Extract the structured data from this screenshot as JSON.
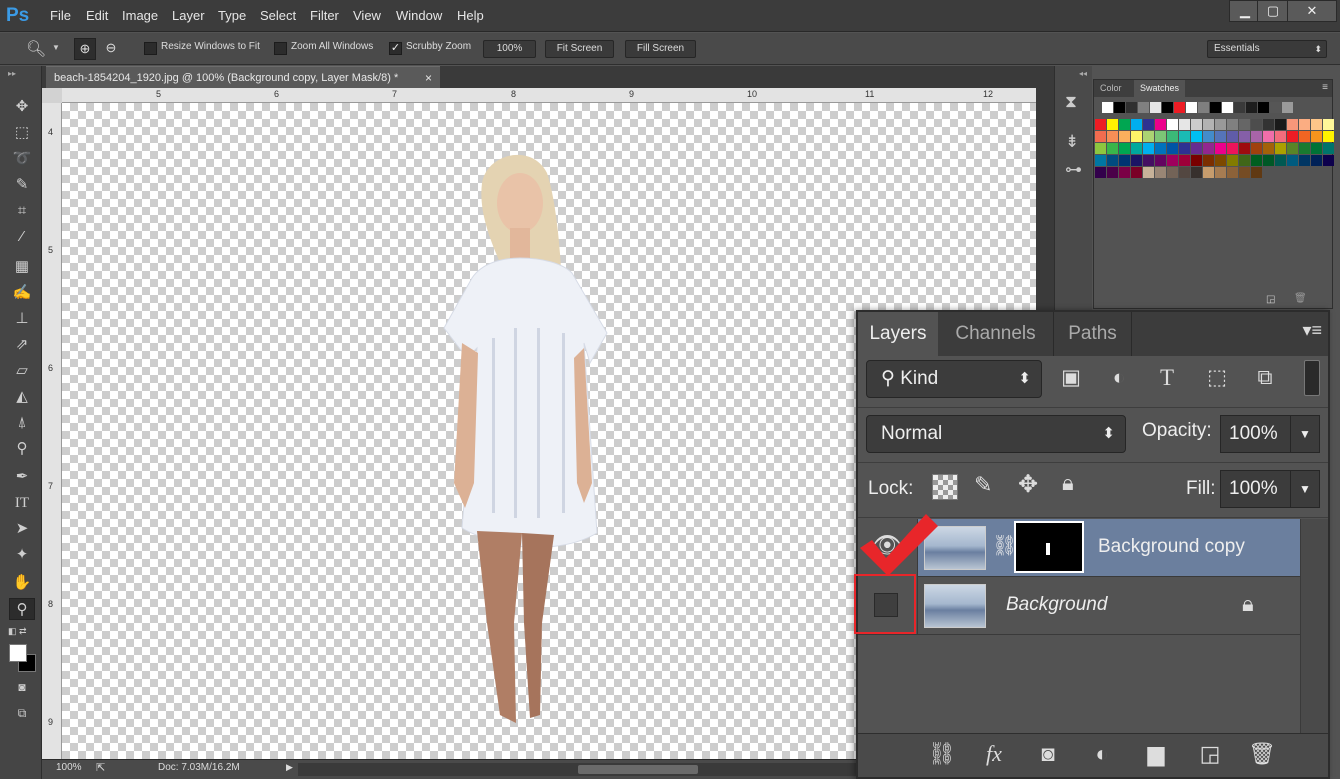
{
  "app": {
    "logo": "Ps"
  },
  "menu": [
    "File",
    "Edit",
    "Image",
    "Layer",
    "Type",
    "Select",
    "Filter",
    "View",
    "Window",
    "Help"
  ],
  "window_controls": {
    "minimize": "▁",
    "restore": "▢",
    "close": "✕"
  },
  "options_bar": {
    "resize_windows_label": "Resize Windows to Fit",
    "zoom_all_label": "Zoom All Windows",
    "scrubby_zoom_label": "Scrubby Zoom",
    "zoom_100_label": "100%",
    "fit_screen_label": "Fit Screen",
    "fill_screen_label": "Fill Screen",
    "workspace": "Essentials",
    "resize_windows_checked": false,
    "zoom_all_checked": false,
    "scrubby_zoom_checked": true
  },
  "document": {
    "tab_title": "beach-1854204_1920.jpg @ 100% (Background copy, Layer Mask/8) *",
    "close": "×"
  },
  "rulers": {
    "top": [
      "5",
      "6",
      "7",
      "8",
      "9",
      "10",
      "11",
      "12"
    ],
    "left": [
      "4",
      "5",
      "6",
      "7",
      "8",
      "9"
    ]
  },
  "status": {
    "zoom": "100%",
    "doc": "Doc: 7.03M/16.2M"
  },
  "swatches": {
    "tabs": [
      "Color",
      "Swatches"
    ],
    "active_tab": "Swatches",
    "row0": [
      "#ffffff",
      "#000000",
      "#303030",
      "#808080",
      "#e6e6e6",
      "#000000",
      "#ed1c24",
      "#ffffff",
      "#7f7f7f",
      "#000000",
      "#ffffff",
      "#3a3a3a",
      "#1e1e1e",
      "#000000",
      "#565656",
      "#9a9a9a"
    ],
    "grid": [
      [
        "#ed1c24",
        "#fff200",
        "#00a651",
        "#00aeef",
        "#2e3192",
        "#ec008c",
        "#ffffff",
        "#e6e6e6",
        "#cccccc",
        "#b3b3b3",
        "#999999",
        "#808080",
        "#666666",
        "#4d4d4d",
        "#333333",
        "#1a1a1a",
        "#f7977a",
        "#fbad82",
        "#fdc689",
        "#fff799"
      ],
      [
        "#f26c4f",
        "#f68e56",
        "#fbaf5d",
        "#fff568",
        "#acd372",
        "#7cc576",
        "#3bb878",
        "#1abbb4",
        "#00bff3",
        "#438ccb",
        "#5574b9",
        "#605ca8",
        "#855fa8",
        "#a864a8",
        "#f06eaa",
        "#f26d7d",
        "#ed1c24",
        "#f26522",
        "#f7941d",
        "#fff200"
      ],
      [
        "#8dc63f",
        "#39b54a",
        "#00a651",
        "#00a99d",
        "#00aeef",
        "#0072bc",
        "#0054a6",
        "#2e3192",
        "#662d91",
        "#92278f",
        "#ec008c",
        "#ed145b",
        "#9e0b0f",
        "#a0410d",
        "#a36209",
        "#aba000",
        "#598527",
        "#197b30",
        "#007236",
        "#00746b"
      ],
      [
        "#0076a3",
        "#004b80",
        "#003471",
        "#1b1464",
        "#440e62",
        "#630460",
        "#9e005d",
        "#9e0039",
        "#790000",
        "#7b2e00",
        "#7d4900",
        "#827b00",
        "#406618",
        "#005e20",
        "#005826",
        "#005952",
        "#005b7f",
        "#003663",
        "#002157",
        "#0d004c"
      ],
      [
        "#32004b",
        "#4b0049",
        "#7b0046",
        "#7a0026",
        "#c7b299",
        "#998675",
        "#736357",
        "#534741",
        "#37302d",
        "#c69c6d",
        "#a67c52",
        "#8c6239",
        "#754c24",
        "#603913"
      ]
    ]
  },
  "layers": {
    "tabs": [
      "Layers",
      "Channels",
      "Paths"
    ],
    "active_tab": "Layers",
    "filter_kind": "Kind",
    "blend_mode": "Normal",
    "opacity_label": "Opacity:",
    "opacity_value": "100%",
    "lock_label": "Lock:",
    "fill_label": "Fill:",
    "fill_value": "100%",
    "items": [
      {
        "name": "Background copy",
        "visible": true,
        "selected": true,
        "has_mask": true
      },
      {
        "name": "Background",
        "visible": false,
        "selected": false,
        "locked": true
      }
    ]
  },
  "annotation": {
    "color": "#e8262a"
  }
}
